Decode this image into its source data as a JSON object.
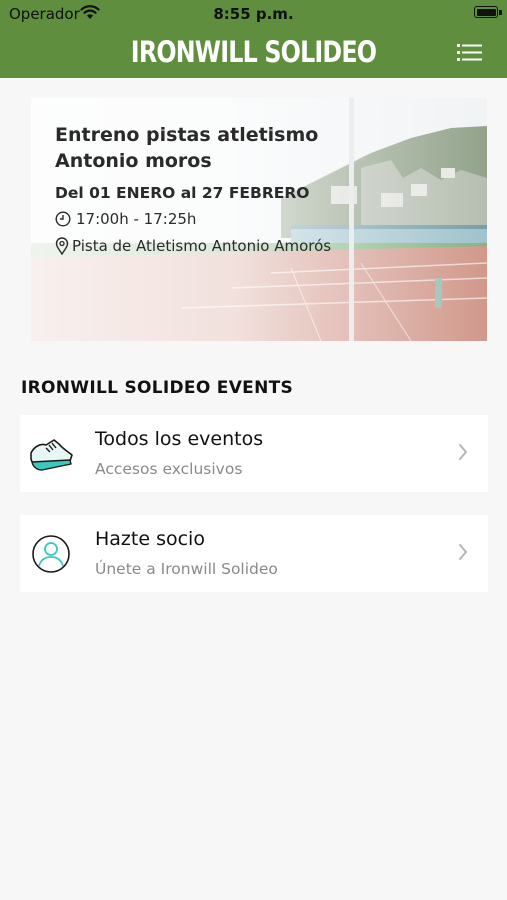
{
  "status_bar": {
    "carrier": "Operador",
    "time": "8:55 p.m."
  },
  "header": {
    "title": "IRONWILL SOLIDEO"
  },
  "banner": {
    "title_line1": "Entreno pistas atletismo",
    "title_line2": "Antonio moros",
    "dates": "Del 01 ENERO al 27 FEBRERO",
    "time": "17:00h - 17:25h",
    "location": "Pista de Atletismo Antonio Amorós"
  },
  "section": {
    "title": "IRONWILL SOLIDEO EVENTS"
  },
  "cards": [
    {
      "title": "Todos los eventos",
      "subtitle": "Accesos exclusivos",
      "icon": "running-shoe-icon"
    },
    {
      "title": "Hazte socio",
      "subtitle": "Únete a Ironwill Solideo",
      "icon": "user-circle-icon"
    }
  ],
  "colors": {
    "header_green": "#5e8e3e",
    "background": "#f7f7f7",
    "track_red": "#c0756a",
    "icon_teal": "#3cc7bf"
  }
}
